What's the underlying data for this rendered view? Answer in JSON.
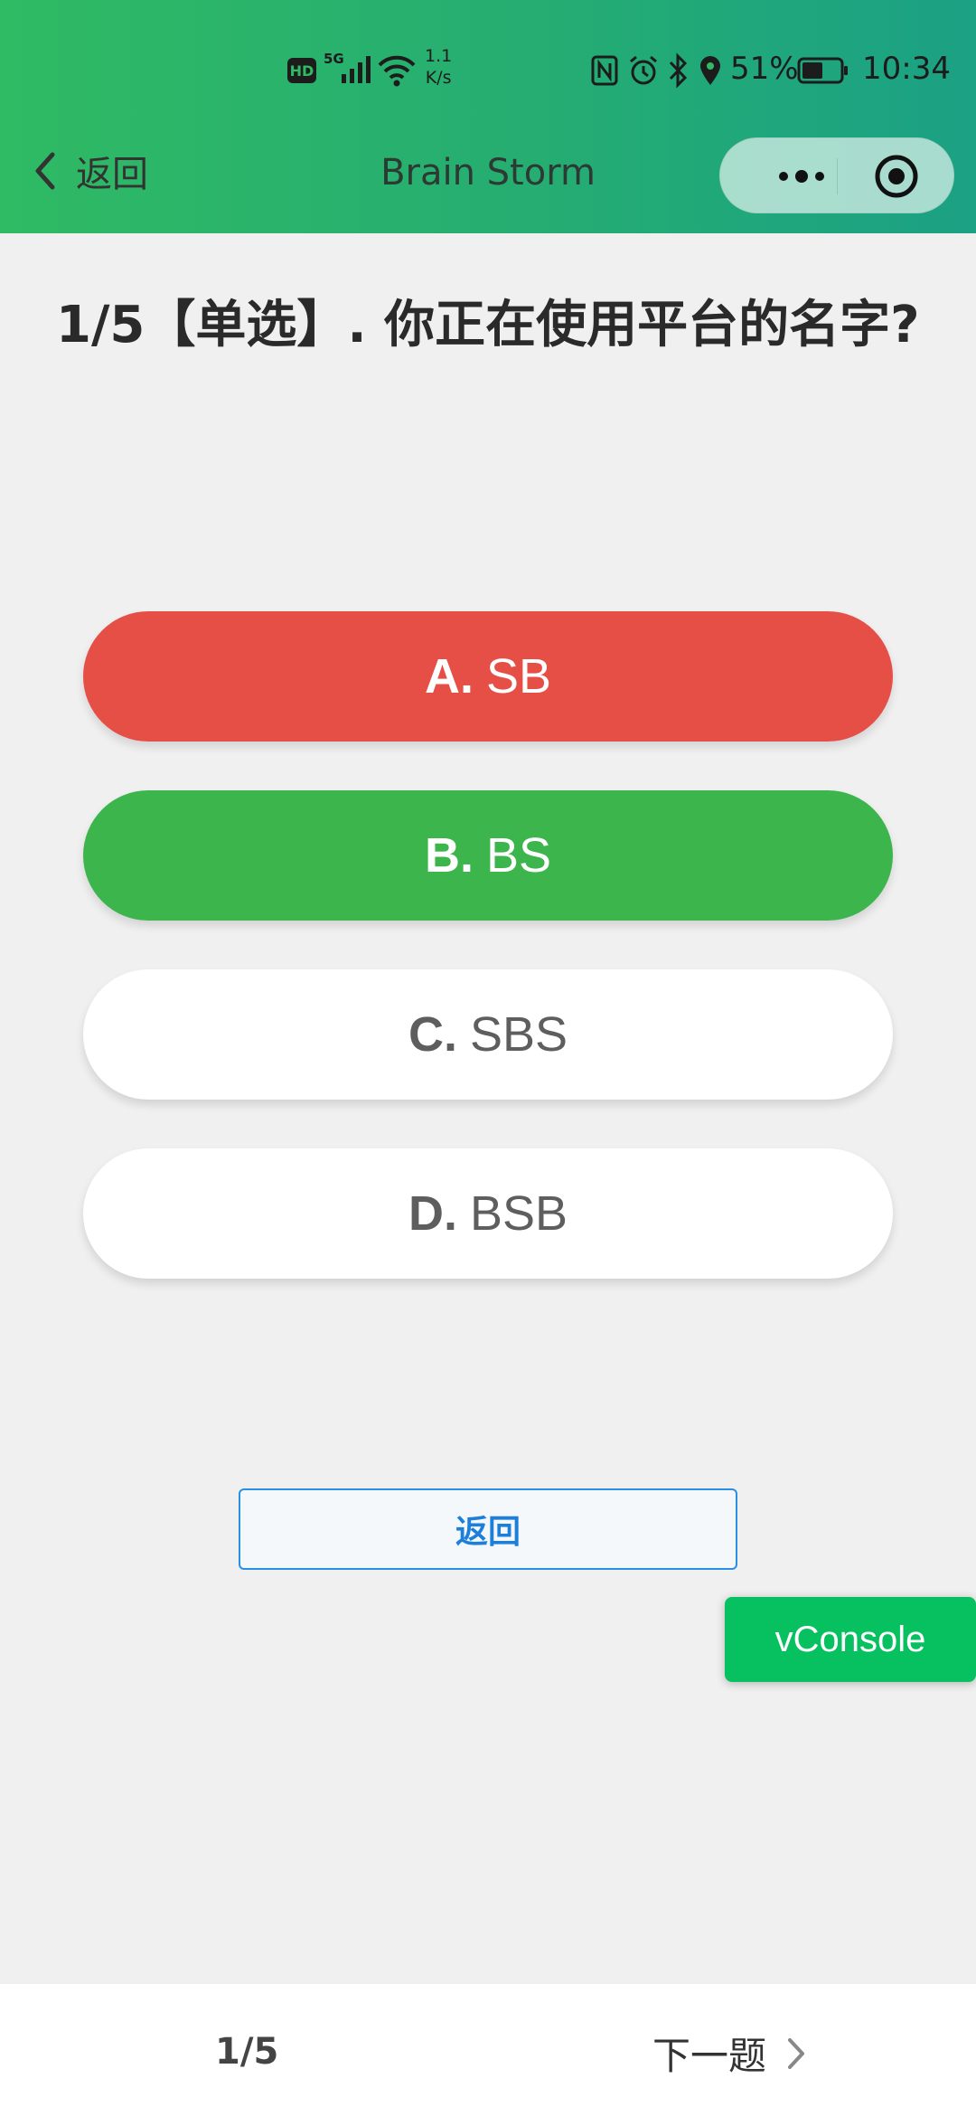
{
  "status_bar": {
    "hd": "HD",
    "network": "5G",
    "net_speed_value": "1.1",
    "net_speed_unit": "K/s",
    "battery_percent": "51%",
    "time": "10:34",
    "icons": [
      "signal-icon",
      "wifi-icon",
      "nfc-icon",
      "alarm-icon",
      "bluetooth-icon",
      "location-icon",
      "battery-icon"
    ]
  },
  "nav": {
    "back_label": "返回",
    "title": "Brain Storm",
    "icons": [
      "chevron-left-icon",
      "more-icon",
      "close-target-icon"
    ]
  },
  "question": {
    "text": "1/5【单选】. 你正在使用平台的名字?"
  },
  "options": [
    {
      "letter": "A.",
      "text": "SB",
      "state": "wrong",
      "color": "#e54f45"
    },
    {
      "letter": "B.",
      "text": "BS",
      "state": "correct",
      "color": "#3cb54c"
    },
    {
      "letter": "C.",
      "text": "SBS",
      "state": "default",
      "color": "#ffffff"
    },
    {
      "letter": "D.",
      "text": "BSB",
      "state": "default",
      "color": "#ffffff"
    }
  ],
  "back_button": {
    "label": "返回"
  },
  "vconsole": {
    "label": "vConsole"
  },
  "bottom_bar": {
    "page_indicator": "1/5",
    "next_label": "下一题"
  },
  "colors": {
    "header_gradient_start": "#2fba64",
    "header_gradient_end": "#1ba184",
    "accent_blue": "#1d7fd9",
    "vconsole_green": "#07c160"
  }
}
